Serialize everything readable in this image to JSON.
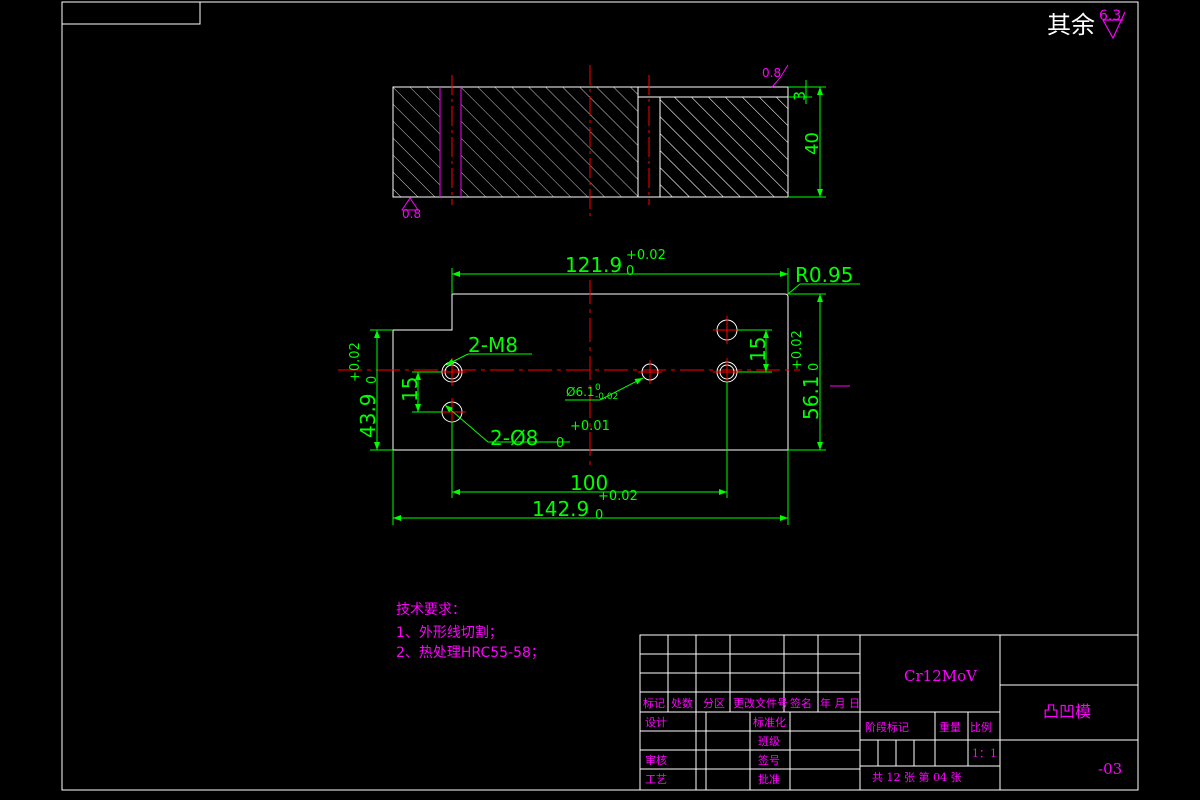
{
  "surface_finish": {
    "default_label": "其余",
    "default_value": "6.3",
    "top_value": "0.8",
    "bottom_value": "0.8"
  },
  "section_view": {
    "dim_height": "40",
    "dim_step": "3"
  },
  "plan_view": {
    "dim_top_length": "121.9",
    "dim_top_length_base": "0",
    "dim_top_length_tol": "+0.02",
    "dim_radius": "R0.95",
    "dim_left_height": "43.9",
    "dim_left_height_base": "0",
    "dim_left_height_tol": "+0.02",
    "dim_right_height": "56.1",
    "dim_right_height_base": "0",
    "dim_right_height_tol": "+0.02",
    "dim_left_spacing": "15",
    "dim_right_spacing": "15",
    "thread_callout": "2-M8",
    "pin_hole_callout": "2-Ø8",
    "pin_hole_base": "0",
    "pin_hole_tol": "+0.01",
    "small_hole_callout": "Ø6.1",
    "small_hole_tol_upper": "0",
    "small_hole_tol_lower": "-0.02",
    "dim_hole_distance": "100",
    "dim_total_length": "142.9",
    "dim_total_length_base": "0",
    "dim_total_length_tol": "+0.02"
  },
  "tech_requirements": {
    "title": "技术要求：",
    "items": [
      "1、外形线切割；",
      "2、热处理HRC55-58；"
    ]
  },
  "title_block": {
    "material": "Cr12MoV",
    "part_name": "凸凹模",
    "drawing_number": "-03",
    "header_cells": [
      "标记",
      "处数",
      "分区",
      "更改文件号",
      "签名",
      "年 月 日"
    ],
    "row_design": "设计",
    "row_standardize": "标准化",
    "row_review": "审核",
    "row_process": "工艺",
    "row_stage": "阶段标记",
    "row_weight": "重量",
    "row_scale": "比例",
    "scale_value": "1：1",
    "row_approve": "批准",
    "row_sign": "签号",
    "row_level": "班级",
    "sheet_info": "共 12  张    第 04  张"
  }
}
